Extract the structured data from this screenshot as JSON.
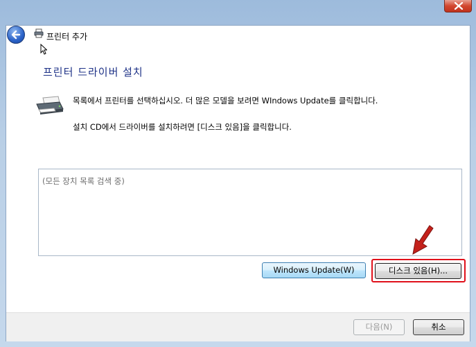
{
  "window": {
    "close_icon": "close-icon"
  },
  "header": {
    "back_icon": "back-arrow-icon",
    "printer_icon": "printer-icon",
    "title": "프린터 추가"
  },
  "main": {
    "heading": "프린터 드라이버 설치",
    "instruction_1": "목록에서 프린터를 선택하십시오. 더 많은 모델을 보려면 WIndows Update를 클릭합니다.",
    "instruction_2": "설치 CD에서 드라이버를 설치하려면 [디스크 있음]을 클릭합니다.",
    "device_list": {
      "status_text": "(모든 장치 목록 검색 중)"
    },
    "buttons": {
      "windows_update": "Windows Update(W)",
      "have_disk": "디스크 있음(H)..."
    }
  },
  "footer": {
    "next": "다음(N)",
    "cancel": "취소"
  },
  "colors": {
    "heading": "#1e3287",
    "highlight": "#e0101a",
    "annotation_arrow": "#c4211b"
  }
}
